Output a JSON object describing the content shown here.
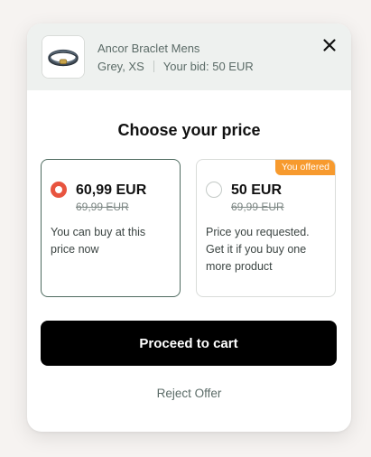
{
  "product": {
    "name": "Ancor Braclet Mens",
    "variant": "Grey, XS",
    "bid_label": "Your bid: 50 EUR",
    "thumbnail_icon": "bracelet-thumbnail"
  },
  "close_icon": "close-icon",
  "title": "Choose your price",
  "options": [
    {
      "price": "60,99 EUR",
      "old_price": "69,99 EUR",
      "description": "You can buy at this price now",
      "selected": true
    },
    {
      "price": "50 EUR",
      "old_price": "69,99 EUR",
      "description": "Price you requested. Get it if you buy one more product",
      "badge": "You offered",
      "selected": false
    }
  ],
  "actions": {
    "proceed_label": "Proceed to cart",
    "reject_label": "Reject Offer"
  },
  "colors": {
    "selected_radio": "#e8543f",
    "selected_border": "#4f6b60",
    "badge_bg": "#f79a2e",
    "header_bg": "#eef1ef",
    "primary_button": "#000000"
  }
}
